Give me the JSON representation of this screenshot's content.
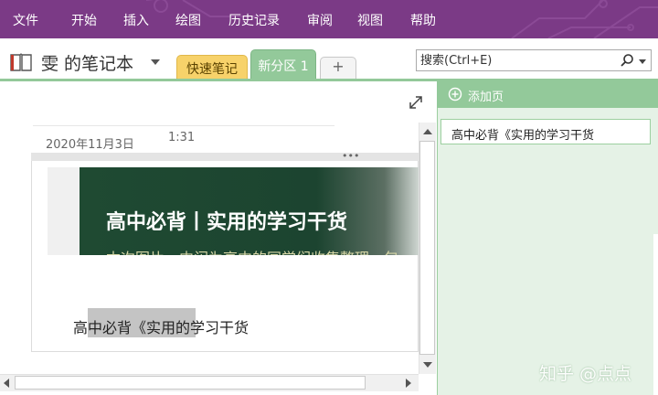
{
  "menu": {
    "items": [
      {
        "label": "文件"
      },
      {
        "label": "开始"
      },
      {
        "label": "插入"
      },
      {
        "label": "绘图"
      },
      {
        "label": "历史记录"
      },
      {
        "label": "审阅"
      },
      {
        "label": "视图"
      },
      {
        "label": "帮助"
      }
    ]
  },
  "notebook": {
    "title": "雯 的笔记本",
    "icon": "notebook-icon"
  },
  "tabs": {
    "quick_notes": "快速笔记",
    "section": "新分区 1",
    "add": "+"
  },
  "search": {
    "placeholder": "搜索(Ctrl+E)",
    "icon": "search-icon"
  },
  "note": {
    "date": "2020年11月3日",
    "time": "1:31",
    "handle": "•••",
    "banner_title": "高中必背丨实用的学习干货",
    "banner_subtitle": "本次图片一内闪为高中的同学们收集整理，包",
    "text": "高中必背《实用的学习干货"
  },
  "pages_pane": {
    "add_page_label": "添加页",
    "pages": [
      {
        "label": "高中必背《实用的学习干货"
      }
    ]
  },
  "watermark": "知乎 @点点",
  "colors": {
    "ribbon": "#7b3a86",
    "section_tab": "#93c99a",
    "quick_tab": "#f7d26a",
    "pane_bg": "#e5f2e6",
    "banner": "#1f4a32"
  }
}
